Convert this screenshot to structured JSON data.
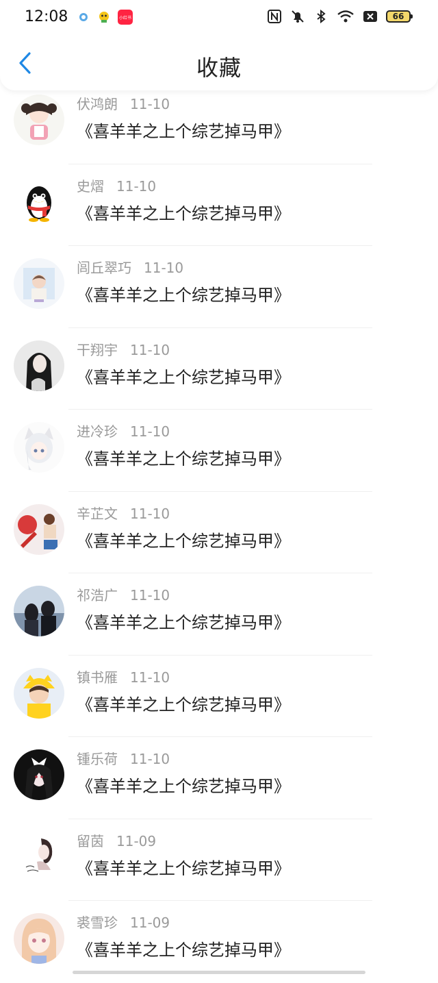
{
  "status_bar": {
    "time": "12:08",
    "battery": "66",
    "icons": [
      "app-notification-icon",
      "app-mascot-icon",
      "app-red-icon",
      "nfc-icon",
      "mute-bell-icon",
      "bluetooth-icon",
      "wifi-icon",
      "sim-off-icon",
      "battery-icon"
    ],
    "red_app_label": "小红书"
  },
  "header": {
    "back_icon": "chevron-left-icon",
    "title": "收藏",
    "accent": "#1e88e5"
  },
  "items": [
    {
      "name": "伏鸿朗",
      "date": "11-10",
      "title": "《喜羊羊之上个综艺掉马甲》",
      "avatar": "anime-girl-avatar"
    },
    {
      "name": "史熠",
      "date": "11-10",
      "title": "《喜羊羊之上个综艺掉马甲》",
      "avatar": "penguin-avatar"
    },
    {
      "name": "闾丘翠巧",
      "date": "11-10",
      "title": "《喜羊羊之上个综艺掉马甲》",
      "avatar": "boy-illustration-avatar"
    },
    {
      "name": "干翔宇",
      "date": "11-10",
      "title": "《喜羊羊之上个综艺掉马甲》",
      "avatar": "woman-photo-avatar"
    },
    {
      "name": "进冷珍",
      "date": "11-10",
      "title": "《喜羊羊之上个综艺掉马甲》",
      "avatar": "white-hair-girl-avatar"
    },
    {
      "name": "辛芷文",
      "date": "11-10",
      "title": "《喜羊羊之上个综艺掉马甲》",
      "avatar": "text-art-avatar"
    },
    {
      "name": "祁浩广",
      "date": "11-10",
      "title": "《喜羊羊之上个综艺掉马甲》",
      "avatar": "couple-photo-avatar"
    },
    {
      "name": "镇书雁",
      "date": "11-10",
      "title": "《喜羊羊之上个综艺掉马甲》",
      "avatar": "yellow-hat-boy-avatar"
    },
    {
      "name": "锺乐荷",
      "date": "11-10",
      "title": "《喜羊羊之上个综艺掉马甲》",
      "avatar": "dark-anime-girl-avatar"
    },
    {
      "name": "留茵",
      "date": "11-09",
      "title": "《喜羊羊之上个综艺掉马甲》",
      "avatar": "sketch-girl-avatar"
    },
    {
      "name": "裘雪珍",
      "date": "11-09",
      "title": "《喜羊羊之上个综艺掉马甲》",
      "avatar": "pink-hair-girl-avatar"
    }
  ]
}
